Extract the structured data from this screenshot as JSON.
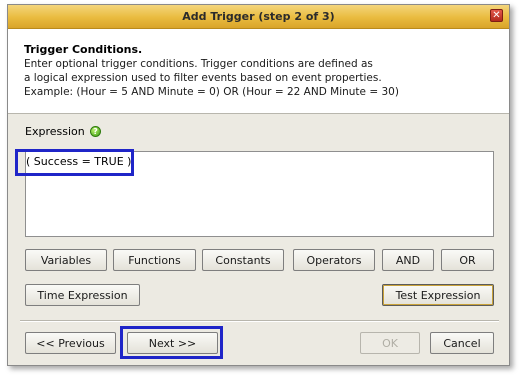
{
  "dialog": {
    "title": "Add Trigger (step 2 of 3)",
    "close_symbol": "✕"
  },
  "header": {
    "title": "Trigger Conditions.",
    "lines": [
      "Enter optional trigger conditions. Trigger conditions are defined as",
      "a logical expression used to filter events based on event properties.",
      "Example: (Hour = 5 AND Minute = 0) OR (Hour = 22 AND Minute = 30)"
    ]
  },
  "expression": {
    "label": "Expression",
    "help_icon": "help-icon",
    "value": "( Success = TRUE )"
  },
  "buttons": {
    "variables": "Variables",
    "functions": "Functions",
    "constants": "Constants",
    "operators": "Operators",
    "and": "AND",
    "or": "OR",
    "time_expression": "Time Expression",
    "test_expression": "Test Expression",
    "previous": "<< Previous",
    "next": "Next >>",
    "ok": "OK",
    "cancel": "Cancel"
  },
  "colors": {
    "highlight": "#1f25c8",
    "titlebar": "#e9bb3f",
    "dialog_bg": "#eceae2"
  }
}
